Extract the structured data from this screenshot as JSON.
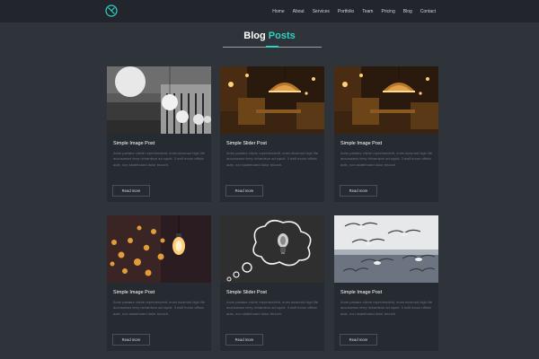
{
  "nav": {
    "links": [
      "Home",
      "About",
      "Services",
      "Portfolio",
      "Team",
      "Pricing",
      "Blog",
      "Contact"
    ]
  },
  "section": {
    "title_main": "Blog",
    "title_accent": "Posts"
  },
  "posts": [
    {
      "title": "Simple Image Post",
      "excerpt": "Anim pariatur cliche reprehenderit, enim eiusmod high life accusamus terry richardson ad squid. 3 wolf moon officia aute, non skateboard dolor brunch.",
      "button": "Read more",
      "image": "hanging-lamps-photo"
    },
    {
      "title": "Simple Slider Post",
      "excerpt": "Anim pariatur cliche reprehenderit, enim eiusmod high life accusamus terry richardson ad squid. 3 wolf moon officia aute, non skateboard dolor brunch.",
      "button": "Read more",
      "image": "restaurant-lamp-photo"
    },
    {
      "title": "Simple Image Post",
      "excerpt": "Anim pariatur cliche reprehenderit, enim eiusmod high life accusamus terry richardson ad squid. 3 wolf moon officia aute, non skateboard dolor brunch.",
      "button": "Read more",
      "image": "restaurant-lamp-photo"
    },
    {
      "title": "Simple Image Post",
      "excerpt": "Anim pariatur cliche reprehenderit, enim eiusmod high life accusamus terry richardson ad squid. 3 wolf moon officia aute, non skateboard dolor brunch.",
      "button": "Read more",
      "image": "bokeh-bulb-photo"
    },
    {
      "title": "Simple Slider Post",
      "excerpt": "Anim pariatur cliche reprehenderit, enim eiusmod high life accusamus terry richardson ad squid. 3 wolf moon officia aute, non skateboard dolor brunch.",
      "button": "Read more",
      "image": "chalkboard-bulb-photo"
    },
    {
      "title": "Simple Image Post",
      "excerpt": "Anim pariatur cliche reprehenderit, enim eiusmod high life accusamus terry richardson ad squid. 3 wolf moon officia aute, non skateboard dolor brunch.",
      "button": "Read more",
      "image": "seagulls-photo"
    }
  ],
  "colors": {
    "accent": "#2fd3c3",
    "background": "#2f343b",
    "navbar": "#22262c",
    "card": "#262a31"
  }
}
